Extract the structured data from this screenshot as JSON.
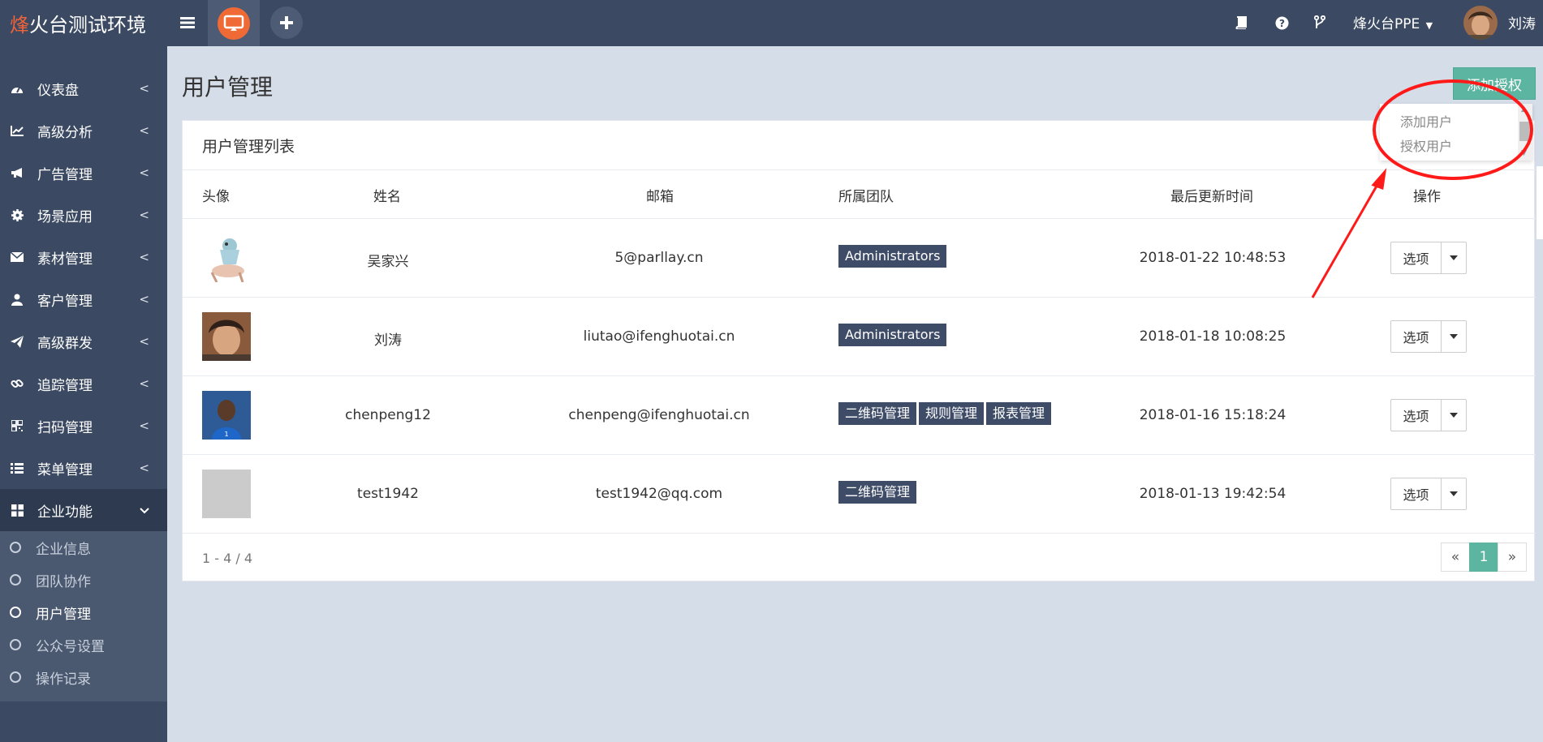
{
  "topbar": {
    "brand_accent": "烽",
    "brand_rest": "火台测试环境",
    "tenant_menu": "烽火台PPE",
    "username": "刘涛",
    "icons": [
      "menu-icon",
      "logo-icon",
      "plus-icon",
      "book-icon",
      "help-icon",
      "branch-icon"
    ]
  },
  "sidebar": {
    "items": [
      {
        "label": "仪表盘",
        "icon": "dashboard-icon"
      },
      {
        "label": "高级分析",
        "icon": "line-chart-icon"
      },
      {
        "label": "广告管理",
        "icon": "bullhorn-icon"
      },
      {
        "label": "场景应用",
        "icon": "gear-icon"
      },
      {
        "label": "素材管理",
        "icon": "envelope-icon"
      },
      {
        "label": "客户管理",
        "icon": "user-icon"
      },
      {
        "label": "高级群发",
        "icon": "paper-plane-icon"
      },
      {
        "label": "追踪管理",
        "icon": "link-icon"
      },
      {
        "label": "扫码管理",
        "icon": "qrcode-icon"
      },
      {
        "label": "菜单管理",
        "icon": "list-icon"
      },
      {
        "label": "企业功能",
        "icon": "grid-icon"
      }
    ],
    "submenu": [
      {
        "label": "企业信息"
      },
      {
        "label": "团队协作"
      },
      {
        "label": "用户管理"
      },
      {
        "label": "公众号设置"
      },
      {
        "label": "操作记录"
      }
    ]
  },
  "page": {
    "title": "用户管理",
    "grant_button": "添加授权",
    "dropdown": [
      "添加用户",
      "授权用户"
    ]
  },
  "panel": {
    "title": "用户管理列表",
    "columns": [
      "头像",
      "姓名",
      "邮箱",
      "所属团队",
      "最后更新时间",
      "操作"
    ],
    "rows": [
      {
        "name": "吴家兴",
        "email": "5@parllay.cn",
        "teams": [
          "Administrators"
        ],
        "updated": "2018-01-22 10:48:53",
        "action": "选项"
      },
      {
        "name": "刘涛",
        "email": "liutao@ifenghuotai.cn",
        "teams": [
          "Administrators"
        ],
        "updated": "2018-01-18 10:08:25",
        "action": "选项"
      },
      {
        "name": "chenpeng12",
        "email": "chenpeng@ifenghuotai.cn",
        "teams": [
          "二维码管理",
          "规则管理",
          "报表管理"
        ],
        "updated": "2018-01-16 15:18:24",
        "action": "选项"
      },
      {
        "name": "test1942",
        "email": "test1942@qq.com",
        "teams": [
          "二维码管理"
        ],
        "updated": "2018-01-13 19:42:54",
        "action": "选项"
      }
    ],
    "pagination": {
      "summary": "1 - 4 / 4",
      "prev": "«",
      "current": "1",
      "next": "»"
    }
  },
  "colors": {
    "topbar_bg": "#3b4a62",
    "page_bg": "#d5dde8",
    "accent_green": "#5cb5a1",
    "tag_bg": "#3f4c68",
    "brand_accent": "#f0633a",
    "annotation_red": "#ff1a1a"
  }
}
